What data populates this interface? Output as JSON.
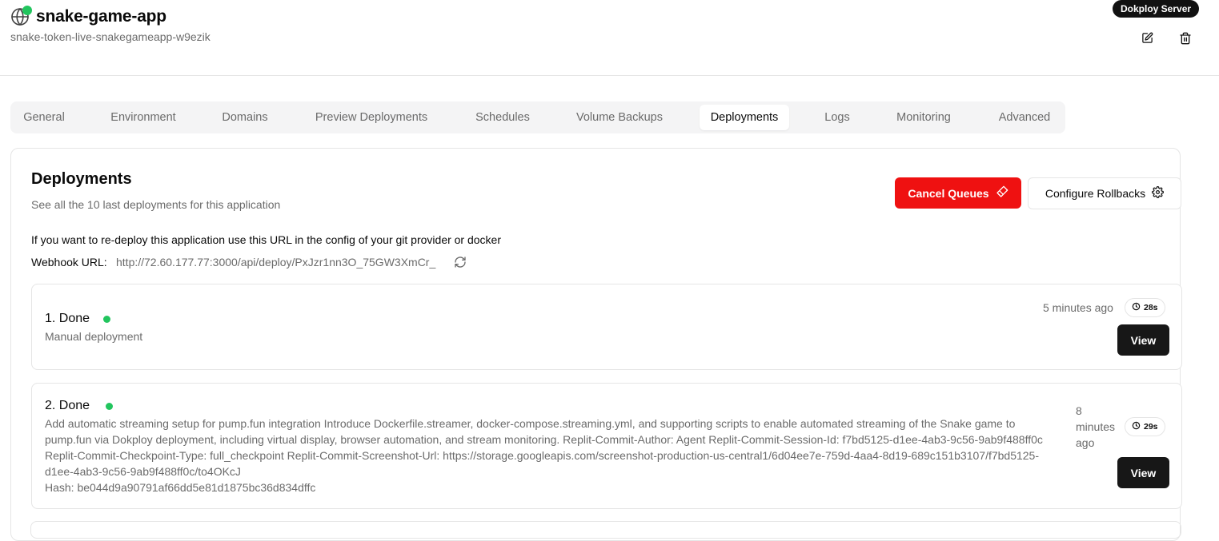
{
  "header": {
    "app_name": "snake-game-app",
    "app_subtitle": "snake-token-live-snakegameapp-w9ezik",
    "server_badge": "Dokploy Server",
    "icons": {
      "app": "globe-icon",
      "edit": "edit-icon",
      "delete": "trash-icon"
    }
  },
  "tabs": [
    {
      "label": "General"
    },
    {
      "label": "Environment"
    },
    {
      "label": "Domains"
    },
    {
      "label": "Preview Deployments"
    },
    {
      "label": "Schedules"
    },
    {
      "label": "Volume Backups"
    },
    {
      "label": "Deployments",
      "active": true
    },
    {
      "label": "Logs"
    },
    {
      "label": "Monitoring"
    },
    {
      "label": "Advanced"
    }
  ],
  "deployments": {
    "title": "Deployments",
    "description": "See all the 10 last deployments for this application",
    "cancel_button": "Cancel Queues",
    "configure_button": "Configure Rollbacks",
    "info_text": "If you want to re-deploy this application use this URL in the config of your git provider or docker",
    "webhook_label": "Webhook URL:",
    "webhook_url": "http://72.60.177.77:3000/api/deploy/PxJzr1nn3O_75GW3XmCr_",
    "items": [
      {
        "status": "1. Done",
        "description": "Manual deployment",
        "time_ago": "5 minutes ago",
        "duration": "28s",
        "view_label": "View"
      },
      {
        "status": "2. Done",
        "description": "Add automatic streaming setup for pump.fun integration Introduce Dockerfile.streamer, docker-compose.streaming.yml, and supporting scripts to enable automated streaming of the Snake game to pump.fun via Dokploy deployment, including virtual display, browser automation, and stream monitoring. Replit-Commit-Author: Agent Replit-Commit-Session-Id: f7bd5125-d1ee-4ab3-9c56-9ab9f488ff0c Replit-Commit-Checkpoint-Type: full_checkpoint Replit-Commit-Screenshot-Url: https://storage.googleapis.com/screenshot-production-us-central1/6d04ee7e-759d-4aa4-8d19-689c151b3107/f7bd5125-d1ee-4ab3-9c56-9ab9f488ff0c/to4OKcJ",
        "hash": "Hash: be044d9a90791af66dd5e81d1875bc36d834dffc",
        "time_ago": "8 minutes ago",
        "duration": "29s",
        "view_label": "View"
      }
    ]
  },
  "colors": {
    "success": "#22c55e",
    "danger": "#ef1111",
    "primary_dark": "#171717"
  }
}
